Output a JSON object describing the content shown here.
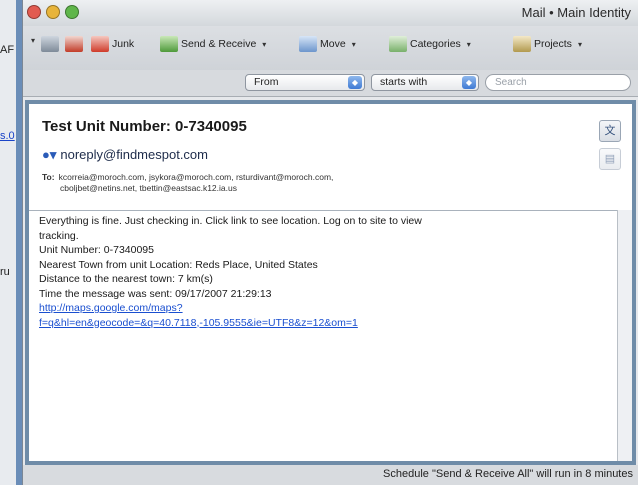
{
  "background_window": {
    "fragments": [
      "AF",
      "s.0",
      "ru"
    ]
  },
  "window": {
    "title": "Mail • Main Identity",
    "traffic_lights": [
      {
        "name": "close-button",
        "color": "#e25b50"
      },
      {
        "name": "minimize-button",
        "color": "#e8b43a"
      },
      {
        "name": "zoom-button",
        "color": "#5fb64a"
      }
    ]
  },
  "toolbar": {
    "items": [
      {
        "label": "",
        "icon": "print-icon"
      },
      {
        "label": "",
        "icon": "delete-icon"
      },
      {
        "label": "Junk",
        "icon": "junk-icon"
      },
      {
        "label": "Send & Receive",
        "icon": "send-receive-icon"
      },
      {
        "label": "Move",
        "icon": "folder-icon"
      },
      {
        "label": "Categories",
        "icon": "categories-icon"
      },
      {
        "label": "Projects",
        "icon": "projects-icon"
      }
    ]
  },
  "filter": {
    "field": "From",
    "operator": "starts with",
    "search_placeholder": "Search"
  },
  "message": {
    "subject": "Test Unit Number: 0-7340095",
    "from": "noreply@findmespot.com",
    "to_label": "To:",
    "to_line1": "kcorreia@moroch.com, jsykora@moroch.com, rsturdivant@moroch.com,",
    "to_line2": "cboljbet@netins.net, tbettin@eastsac.k12.ia.us",
    "body_lines": [
      "Everything is fine. Just checking in. Click link to see location. Log on to site to view",
      "tracking.",
      "Unit Number: 0-7340095",
      "Nearest Town from unit Location:  Reds Place, United States",
      "Distance to the nearest town:  7 km(s)",
      "Time the message was sent: 09/17/2007 21:29:13"
    ],
    "link_line1": "http://maps.google.com/maps?",
    "link_line2": "f=q&hl=en&geocode=&q=40.7118,-105.9555&ie=UTF8&z=12&om=1"
  },
  "status": {
    "text": "Schedule \"Send & Receive All\" will run in 8 minutes"
  },
  "colors": {
    "desktop": "#a7cfdc",
    "frame_border": "#6f8ca8",
    "link": "#1a4fd0"
  }
}
